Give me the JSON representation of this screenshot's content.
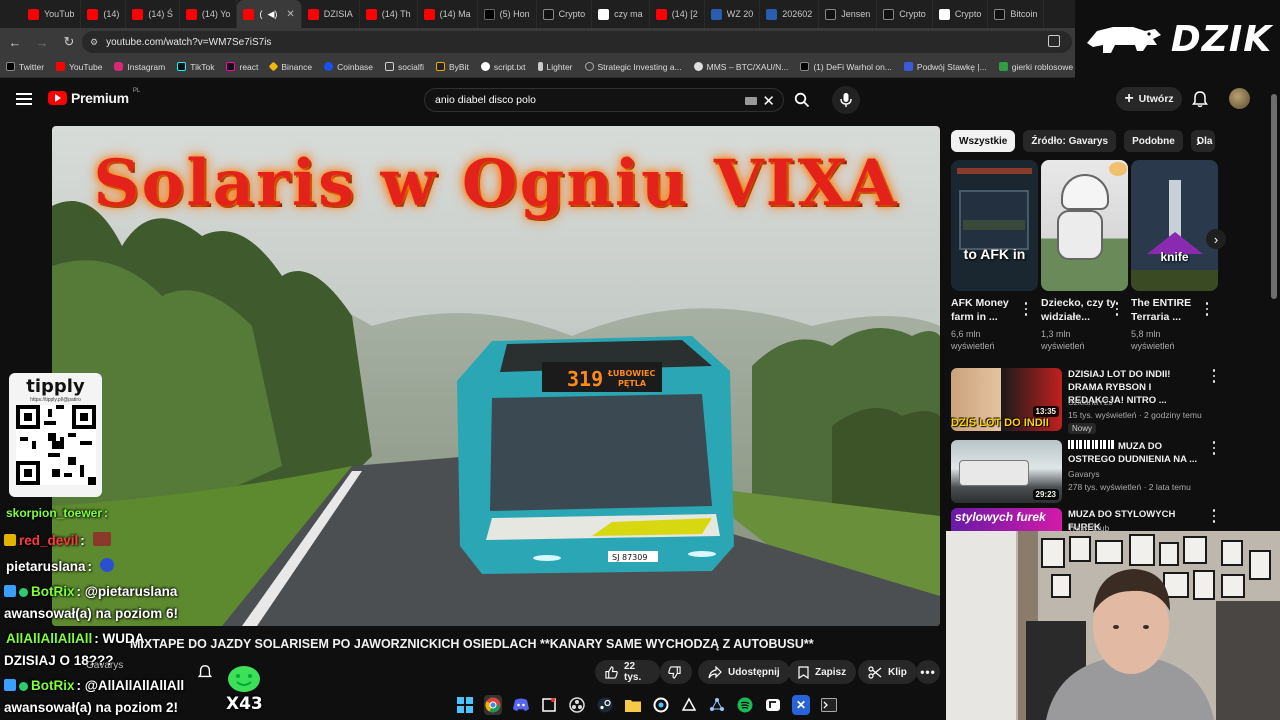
{
  "browser": {
    "tabs": [
      {
        "label": "YouTub",
        "icon": "youtube-icon"
      },
      {
        "label": "(14) ",
        "icon": "youtube-icon"
      },
      {
        "label": "(14) Ś",
        "icon": "youtube-icon"
      },
      {
        "label": "(14) Yo",
        "icon": "youtube-icon"
      },
      {
        "label": "(",
        "icon": "youtube-icon",
        "active": true
      },
      {
        "label": "DZISIA",
        "icon": "youtube-icon"
      },
      {
        "label": "(14) Th",
        "icon": "youtube-icon"
      },
      {
        "label": "(14) Ma",
        "icon": "youtube-icon"
      },
      {
        "label": "(5) Hon",
        "icon": "x-icon"
      },
      {
        "label": "Crypto",
        "icon": "site-icon"
      },
      {
        "label": "czy ma",
        "icon": "google-icon"
      },
      {
        "label": "(14) [2",
        "icon": "youtube-icon"
      },
      {
        "label": "WZ 20",
        "icon": "site-icon"
      },
      {
        "label": "202602",
        "icon": "doc-icon"
      },
      {
        "label": "Jensen",
        "icon": "site-icon"
      },
      {
        "label": "Crypto",
        "icon": "site-icon"
      },
      {
        "label": "Crypto",
        "icon": "google-icon"
      },
      {
        "label": "Bitcoin",
        "icon": "site-icon"
      }
    ],
    "url": "youtube.com/watch?v=WM7Se7iS7is",
    "bookmarks": [
      "Twitter",
      "YouTube",
      "Instagram",
      "TikTok",
      "react",
      "Binance",
      "Coinbase",
      "socialfi",
      "ByBit",
      "script.txt",
      "Lighter",
      "Strategic Investing a...",
      "MMS – BTC/XAU/N...",
      "(1) DeFi Warhol on...",
      "Podwój Stawkę |...",
      "gierki roblosowe do"
    ]
  },
  "overlay_logo": "DZIK",
  "youtube": {
    "logo_text": "Premium",
    "logo_region": "PL",
    "search_value": "anio diabel  disco polo",
    "create_label": "Utwórz"
  },
  "video": {
    "overlay_title": "Solaris w Ogniu VIXA",
    "bus_route": "319",
    "bus_destination_1": "ŁUBOWIEC",
    "bus_destination_2": "PĘTLA",
    "bus_plate": "SJ 87309",
    "title": "MIXTAPE DO JAZDY SOLARISEM PO JAWORZNICKICH OSIEDLACH **KANARY SAME WYCHODZĄ Z AUTOBUSU**",
    "channel": "Gavarys",
    "likes": "22 tys.",
    "share_label": "Udostępnij",
    "save_label": "Zapisz",
    "clip_label": "Klip"
  },
  "stream_overlay": {
    "tipply_logo": "tipply",
    "tipply_url": "https://tipply.pl/@patiro",
    "counter": "X43",
    "chat": [
      {
        "name": "skorpion_toewer",
        "text": ":"
      },
      {
        "name": "red_devil",
        "text": ":"
      },
      {
        "name": "pietaruslana",
        "text": ":"
      },
      {
        "name": "BotRix",
        "text": ": @pietaruslana"
      },
      {
        "name": "",
        "text": "awansował(a) na poziom 6!"
      },
      {
        "name": "AllAllAllAllAll",
        "text": ": WUDA"
      },
      {
        "name": "",
        "text": "DZISIAJ O 18???"
      },
      {
        "name": "BotRix",
        "text": ": @AllAllAllAllAll"
      },
      {
        "name": "",
        "text": "awansował(a) na poziom 2!"
      }
    ]
  },
  "sidebar": {
    "chips": [
      "Wszystkie",
      "Źródło: Gavarys",
      "Podobne",
      "Dla"
    ],
    "shorts": [
      {
        "title": "AFK Money farm in ...",
        "views": "6,6 mln wyświetleń",
        "thumb_text": "to AFK in"
      },
      {
        "title": "Dziecko, czy ty widziałe...",
        "views": "1,3 mln wyświetleń",
        "thumb_text": ""
      },
      {
        "title": "The ENTIRE Terraria ...",
        "views": "5,8 mln wyświetleń",
        "thumb_text": "knife"
      }
    ],
    "recommendations": [
      {
        "title": "DZISIAJ LOT DO INDII! DRAMA RYBSON I REDAKCJA! NITRO ...",
        "channel": "SzklanaY2J",
        "meta": "15 tys. wyświetleń · 2 godziny temu",
        "badge": "Nowy",
        "duration": "13:35",
        "thumb_text": "DZIŚ LOT DO INDII"
      },
      {
        "title": "MUZA DO OSTREGO DUDNIENIA NA ...",
        "channel": "Gavarys",
        "meta": "278 tys. wyświetleń · 2 lata temu",
        "duration": "29:23",
        "thumb_text": ""
      },
      {
        "title": "MUZA DO STYLOWYCH FUREK",
        "channel": "Trash Club",
        "meta": "",
        "duration": "",
        "thumb_text": "stylowych furek"
      }
    ]
  },
  "colors": {
    "accent": "#ff0000",
    "background": "#0f0f0f",
    "chip": "#272727",
    "chat_green": "#7dff3a",
    "chat_red": "#ff3a3a",
    "botrix_blue": "#39a0ff"
  }
}
